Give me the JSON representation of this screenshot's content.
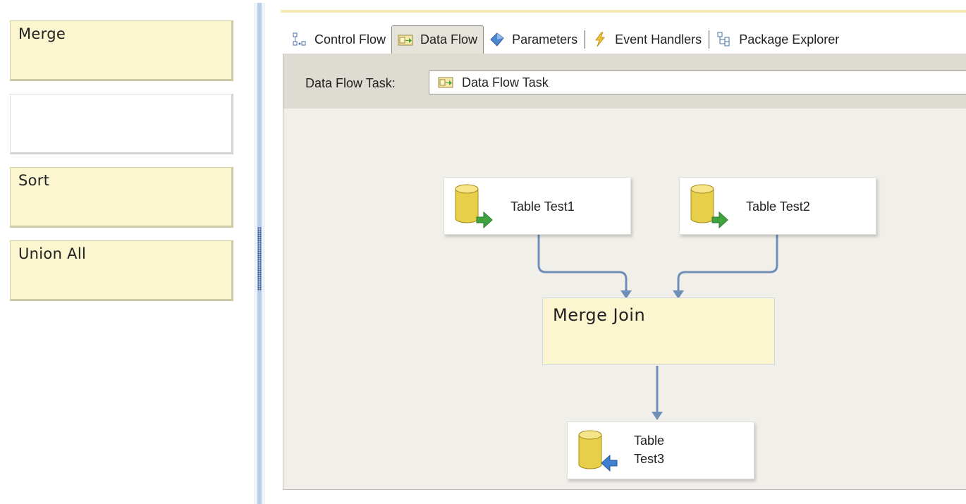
{
  "answer_area": {
    "boxes": [
      {
        "label": "Merge"
      },
      {
        "label": ""
      },
      {
        "label": "Sort"
      },
      {
        "label": "Union All"
      }
    ]
  },
  "designer": {
    "tabs": [
      {
        "label": "Control Flow",
        "icon": "control-flow-icon",
        "active": false
      },
      {
        "label": "Data Flow",
        "icon": "data-flow-icon",
        "active": true
      },
      {
        "label": "Parameters",
        "icon": "parameters-icon",
        "active": false
      },
      {
        "label": "Event Handlers",
        "icon": "event-handlers-icon",
        "active": false
      },
      {
        "label": "Package Explorer",
        "icon": "package-explorer-icon",
        "active": false
      }
    ],
    "task_label": "Data Flow Task:",
    "task_value": "Data Flow Task",
    "components": {
      "source1": "Table Test1",
      "source2": "Table Test2",
      "merge_join": "Merge Join",
      "destination_line1": "Table",
      "destination_line2": "Test3"
    }
  },
  "colors": {
    "answer_fill": "#fbf6cf",
    "connector": "#6f8fb8",
    "cylinder": "#e8cf4a",
    "arrow_green": "#3fa33f",
    "arrow_blue": "#3d7fd0"
  }
}
